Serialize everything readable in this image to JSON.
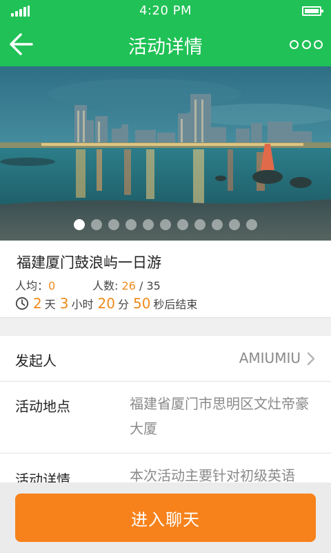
{
  "status_bar": {
    "time": "4:20 PM"
  },
  "header": {
    "title": "活动详情",
    "back_icon": "arrow-left-icon",
    "more_icon": "more-dots-icon"
  },
  "banner": {
    "dot_count": 11,
    "active_index": 0
  },
  "activity": {
    "title": "福建厦门鼓浪屿一日游",
    "per_capita_label": "人均：",
    "per_capita_value": "0",
    "people_label": "人数:",
    "people_current": "26",
    "people_separator": "/",
    "people_total": "35",
    "countdown": {
      "days": "2",
      "days_unit": "天",
      "hours": "3",
      "hours_unit": "小时",
      "minutes": "20",
      "minutes_unit": "分",
      "seconds": "50",
      "seconds_unit": "秒后结束"
    }
  },
  "details": {
    "organizer_label": "发起人",
    "organizer_value": "AMIUMIU",
    "location_label": "活动地点",
    "location_value": "福建省厦门市思明区文灶帝豪大厦",
    "detail_label": "活动详情",
    "detail_value": "本次活动主要针对初级英语"
  },
  "footer": {
    "chat_button": "进入聊天"
  },
  "colors": {
    "primary_green": "#20c156",
    "accent_orange": "#f7821b",
    "number_orange": "#f08a1c"
  }
}
